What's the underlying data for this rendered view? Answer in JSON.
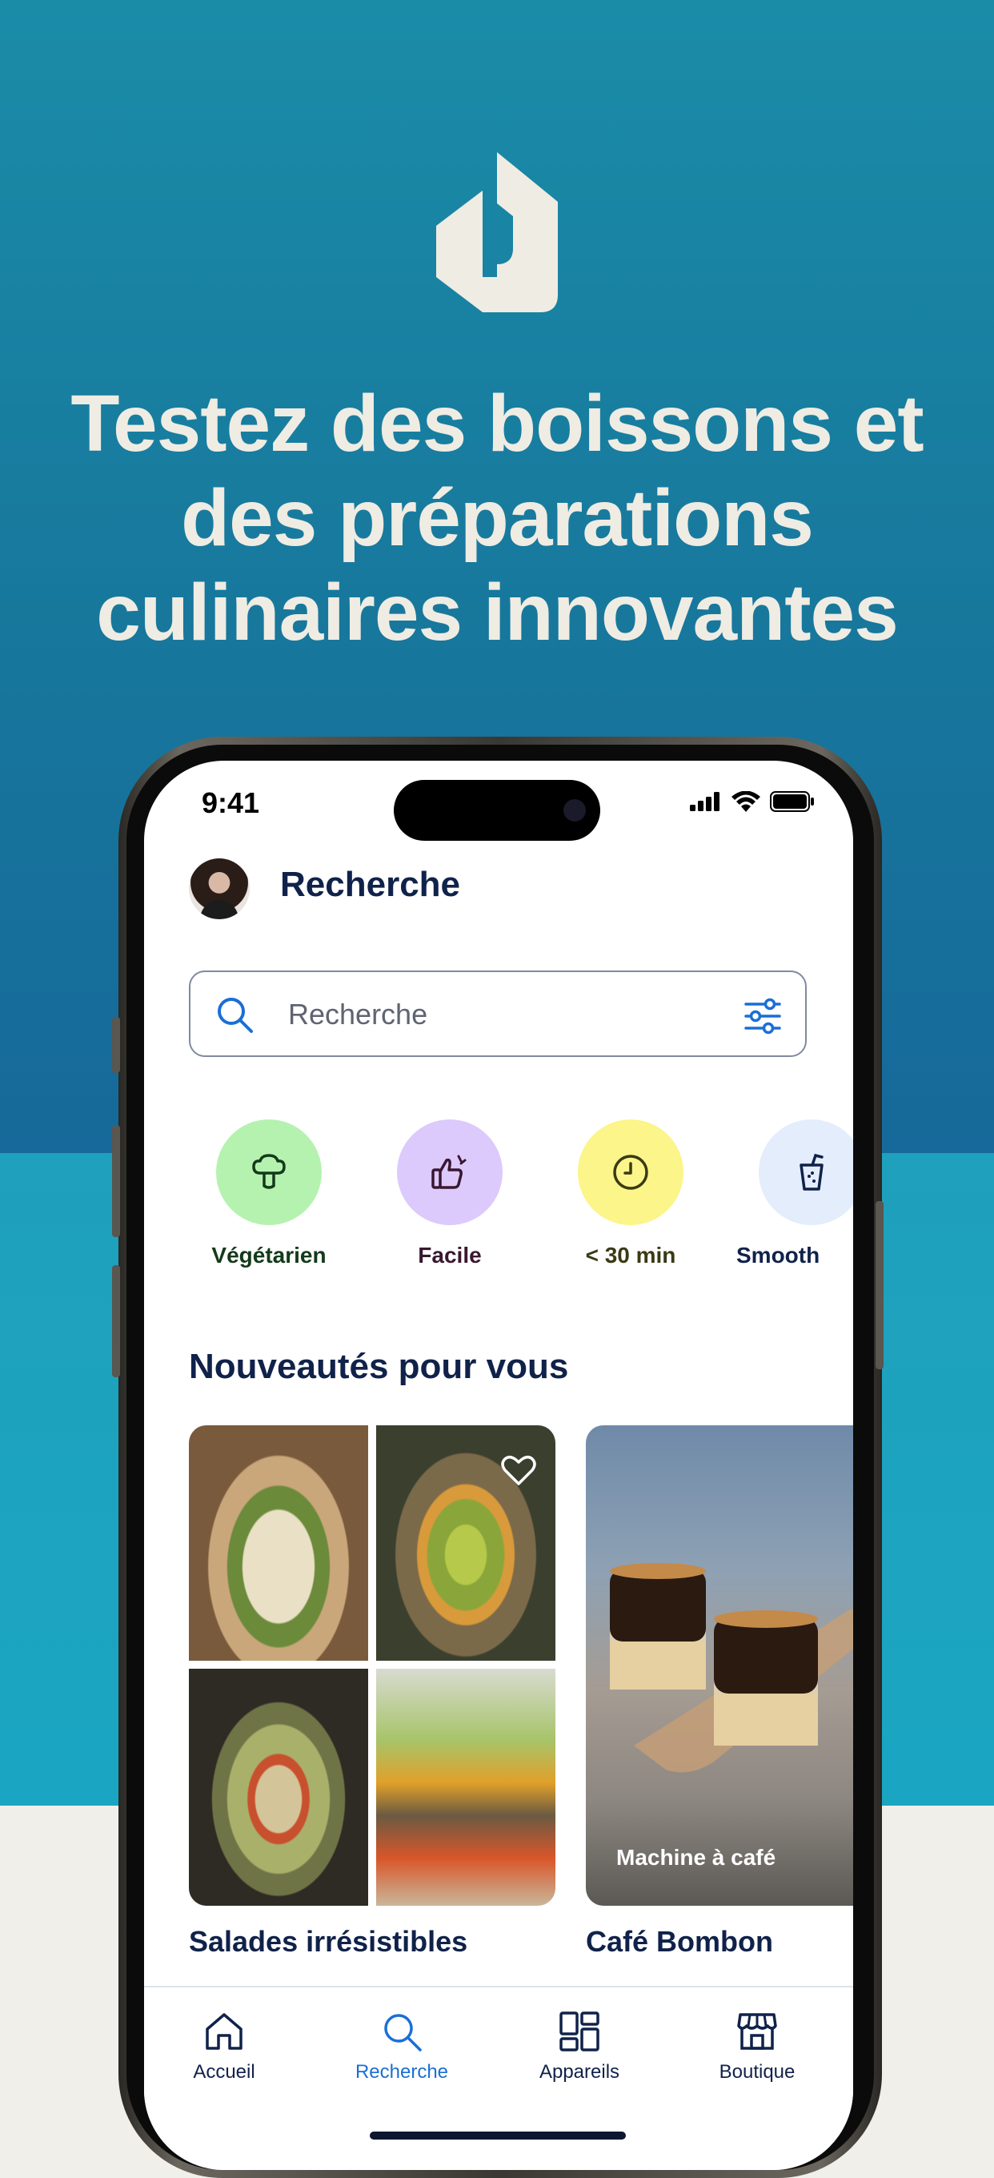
{
  "promo": {
    "headline_lines": [
      "Testez des boissons et",
      "des préparations",
      "culinaires innovantes"
    ]
  },
  "status_bar": {
    "time": "9:41"
  },
  "header": {
    "title": "Recherche",
    "avatar": "user-avatar"
  },
  "search": {
    "placeholder": "Recherche",
    "icon": "search-icon",
    "filter_icon": "filter-sliders-icon"
  },
  "categories": [
    {
      "label": "Végétarien",
      "icon": "broccoli-icon",
      "color": "#b5f2b0",
      "label_color": "#143a1a"
    },
    {
      "label": "Facile",
      "icon": "thumbs-up-icon",
      "color": "#dccafc",
      "label_color": "#3a1730"
    },
    {
      "label": "< 30 min",
      "icon": "clock-icon",
      "color": "#fbf58a",
      "label_color": "#3a3a14"
    },
    {
      "label": "Smooth",
      "icon": "smoothie-cup-icon",
      "color": "#e4edfb",
      "label_color": "#10224a"
    }
  ],
  "section": {
    "title": "Nouveautés pour vous"
  },
  "cards": [
    {
      "title": "Salades irrésistibles",
      "favorite_icon": "heart-icon"
    },
    {
      "title": "Café Bombon",
      "badge": "Machine à café"
    }
  ],
  "tabbar": {
    "items": [
      {
        "label": "Accueil",
        "icon": "home-icon",
        "active": false
      },
      {
        "label": "Recherche",
        "icon": "search-icon",
        "active": true
      },
      {
        "label": "Appareils",
        "icon": "devices-grid-icon",
        "active": false
      },
      {
        "label": "Boutique",
        "icon": "store-icon",
        "active": false
      }
    ]
  },
  "colors": {
    "brand_dark": "#10224a",
    "accent": "#1a6fd6",
    "promo_background": "#17779c",
    "promo_text": "#efece3"
  }
}
